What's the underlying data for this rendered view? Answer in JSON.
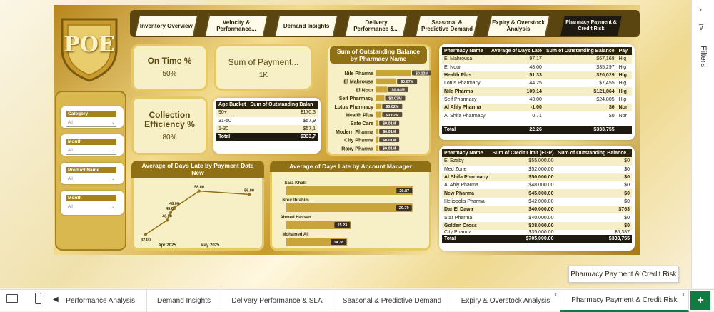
{
  "logo_text": "POE",
  "nav": [
    {
      "label": "Inventory Overview"
    },
    {
      "label": "Velocity & Performance..."
    },
    {
      "label": "Demand Insights"
    },
    {
      "label": "Delivery Performance &..."
    },
    {
      "label": "Seasonal & Predictive Demand"
    },
    {
      "label": "Expiry & Overstock Analysis"
    },
    {
      "label": "Pharmacy Payment & Credit Risk"
    }
  ],
  "kpis": {
    "on_time": {
      "title": "On Time %",
      "value": "50%"
    },
    "payment": {
      "title": "Sum of Payment...",
      "value": "1K"
    },
    "collection": {
      "title": "Collection Efficiency %",
      "value": "80%"
    }
  },
  "filters": [
    {
      "label": "Category",
      "value": "All"
    },
    {
      "label": "Month",
      "value": "All"
    },
    {
      "label": "Product Name",
      "value": "All"
    },
    {
      "label": "Month",
      "value": "All"
    }
  ],
  "age_table": {
    "headers": [
      "Age Bucket",
      "Sum of Outstanding Balan"
    ],
    "rows": [
      [
        "90+",
        "$170,3"
      ],
      [
        "31-60",
        "$57,9"
      ],
      [
        "1-30",
        "$57,1"
      ]
    ],
    "total": [
      "Total",
      "$333,7"
    ]
  },
  "outstanding_chart": {
    "title": "Sum of Outstanding Balance by Pharmacy Name",
    "categories": [
      "Nile Pharma",
      "El Mahrousa",
      "El Nour",
      "Seif Pharmacy",
      "Lotus Pharmacy",
      "Health Plus",
      "Safe Care",
      "Modern Pharma",
      "City Pharma",
      "Roxy Pharma"
    ],
    "values": [
      0.12,
      0.07,
      0.04,
      0.03,
      0.02,
      0.02,
      0.01,
      0.01,
      0.01,
      0.01
    ],
    "labels": [
      "$0.12M",
      "$0.07M",
      "$0.04M",
      "$0.03M",
      "$0.02M",
      "$0.02M",
      "$0.01M",
      "$0.01M",
      "$0.01M",
      "$0.01M"
    ]
  },
  "late_table": {
    "headers": [
      "Pharmacy Name",
      "Average of Days Late",
      "Sum of Outstanding Balance",
      "Pay"
    ],
    "rows": [
      [
        "El Mahrousa",
        "97.17",
        "$67,168",
        "Hig"
      ],
      [
        "El Nour",
        "48.00",
        "$35,297",
        "Hig"
      ],
      [
        "Health Plus",
        "51.33",
        "$20,029",
        "Hig"
      ],
      [
        "Lotus Pharmacy",
        "44.25",
        "$7,455",
        "Hig"
      ],
      [
        "Nile Pharma",
        "109.14",
        "$121,864",
        "Hig"
      ],
      [
        "Seif Pharmacy",
        "43.00",
        "$24,805",
        "Hig"
      ],
      [
        "Al Ahly Pharma",
        "-1.00",
        "$0",
        "Nor"
      ],
      [
        "Al Shifa Pharmacy",
        "0.71",
        "$0",
        "Nor"
      ]
    ],
    "total": [
      "Total",
      "22.26",
      "$333,755",
      ""
    ]
  },
  "line_chart": {
    "title": "Average of Days Late by Payment Date New",
    "x_ticks": [
      "Apr 2025",
      "May 2025"
    ],
    "values": [
      32.0,
      40.5,
      45.0,
      48.0,
      58.0,
      56.0
    ],
    "labels": [
      "32.00",
      "40.50",
      "45.00",
      "48.00",
      "58.00",
      "56.00"
    ]
  },
  "manager_chart": {
    "title": "Average of Days Late by Account Manager",
    "categories": [
      "Sara Khalil",
      "Nour Ibrahim",
      "Ahmed Hassan",
      "Mohamed Ali"
    ],
    "values": [
      29.87,
      29.79,
      15.23,
      14.38
    ],
    "labels": [
      "29.87",
      "29.79",
      "15.23",
      "14.38"
    ]
  },
  "credit_table": {
    "headers": [
      "Pharmacy Name",
      "Sum of Credit Limit (EGP)",
      "Sum of Outstanding Balance"
    ],
    "rows": [
      [
        "El Ezaby",
        "$55,000.00",
        "$0"
      ],
      [
        "Med Zone",
        "$52,000.00",
        "$0"
      ],
      [
        "Al Shifa Pharmacy",
        "$50,000.00",
        "$0"
      ],
      [
        "Al Ahly Pharma",
        "$48,000.00",
        "$0"
      ],
      [
        "New Pharma",
        "$45,000.00",
        "$0"
      ],
      [
        "Heliopolis Pharma",
        "$42,000.00",
        "$0"
      ],
      [
        "Dar El Dawa",
        "$40,000.00",
        "$763"
      ],
      [
        "Star Pharma",
        "$40,000.00",
        "$0"
      ],
      [
        "Golden Cross",
        "$38,000.00",
        "$0"
      ],
      [
        "City Pharma",
        "$35,000.00",
        "$6,387"
      ]
    ],
    "total": [
      "Total",
      "$705,000.00",
      "$333,755"
    ]
  },
  "tooltip": "Pharmacy Payment & Credit Risk",
  "tabs": [
    "Performance Analysis",
    "Demand Insights",
    "Delivery Performance & SLA",
    "Seasonal & Predictive Demand",
    "Expiry & Overstock Analysis",
    "Pharmacy Payment & Credit Risk"
  ],
  "filters_pane": "Filters"
}
